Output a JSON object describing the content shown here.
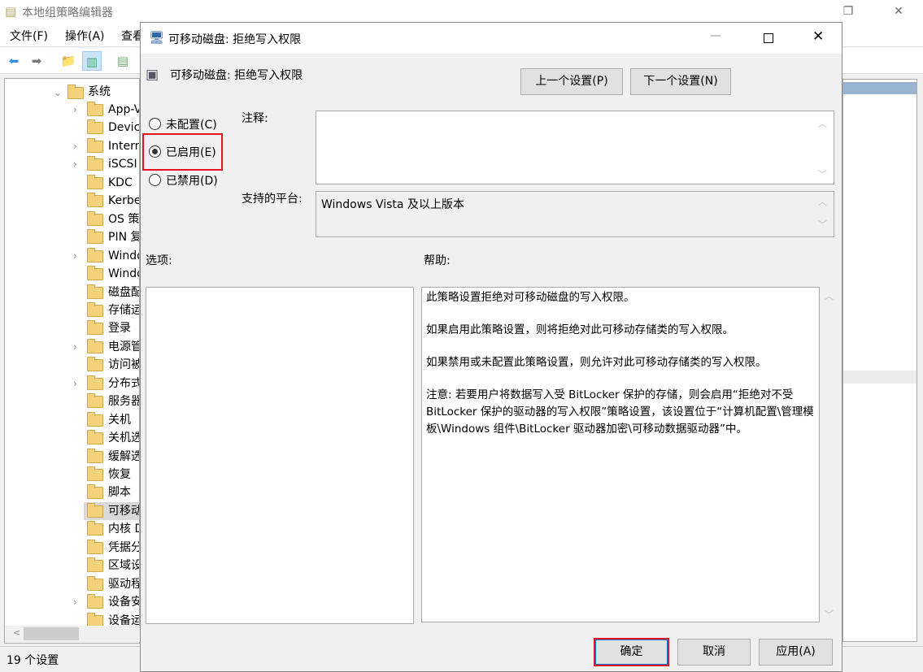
{
  "main_window": {
    "title": "本地组策略编辑器",
    "menu": [
      "文件(F)",
      "操作(A)",
      "查看"
    ],
    "tree": {
      "root": "系统",
      "items": [
        {
          "label": "App-V",
          "expandable": true
        },
        {
          "label": "Device",
          "expandable": false
        },
        {
          "label": "Internet",
          "expandable": true
        },
        {
          "label": "iSCSI",
          "expandable": true
        },
        {
          "label": "KDC",
          "expandable": false
        },
        {
          "label": "Kerberos",
          "expandable": false
        },
        {
          "label": "OS 策",
          "expandable": false
        },
        {
          "label": "PIN 复",
          "expandable": false
        },
        {
          "label": "Windows",
          "expandable": true
        },
        {
          "label": "Windows",
          "expandable": false
        },
        {
          "label": "磁盘配",
          "expandable": false
        },
        {
          "label": "存储运",
          "expandable": false
        },
        {
          "label": "登录",
          "expandable": false
        },
        {
          "label": "电源管",
          "expandable": true
        },
        {
          "label": "访问被",
          "expandable": false
        },
        {
          "label": "分布式",
          "expandable": true
        },
        {
          "label": "服务器",
          "expandable": false
        },
        {
          "label": "关机",
          "expandable": false
        },
        {
          "label": "关机选",
          "expandable": false
        },
        {
          "label": "缓解选",
          "expandable": false
        },
        {
          "label": "恢复",
          "expandable": false
        },
        {
          "label": "脚本",
          "expandable": false
        },
        {
          "label": "可移动",
          "expandable": false,
          "selected": true
        },
        {
          "label": "内核 D",
          "expandable": false
        },
        {
          "label": "凭据分",
          "expandable": false
        },
        {
          "label": "区域设",
          "expandable": false
        },
        {
          "label": "驱动程",
          "expandable": false
        },
        {
          "label": "设备安",
          "expandable": true
        },
        {
          "label": "设备运",
          "expandable": false
        }
      ]
    },
    "status": "19 个设置"
  },
  "dialog": {
    "title": "可移动磁盘: 拒绝写入权限",
    "heading": "可移动磁盘: 拒绝写入权限",
    "prev_button": "上一个设置(P)",
    "next_button": "下一个设置(N)",
    "radios": [
      {
        "label": "未配置(C)",
        "checked": false
      },
      {
        "label": "已启用(E)",
        "checked": true
      },
      {
        "label": "已禁用(D)",
        "checked": false
      }
    ],
    "comment_label": "注释:",
    "comment_value": "",
    "platform_label": "支持的平台:",
    "platform_value": "Windows Vista 及以上版本",
    "options_label": "选项:",
    "help_label": "帮助:",
    "help_paragraphs": [
      "此策略设置拒绝对可移动磁盘的写入权限。",
      "如果启用此策略设置，则将拒绝对此可移动存储类的写入权限。",
      "如果禁用或未配置此策略设置，则允许对此可移动存储类的写入权限。",
      "注意: 若要用户将数据写入受 BitLocker 保护的存储，则会启用“拒绝对不受 BitLocker 保护的驱动器的写入权限”策略设置，该设置位于“计算机配置\\管理模板\\Windows 组件\\BitLocker 驱动器加密\\可移动数据驱动器”中。"
    ],
    "ok_button": "确定",
    "cancel_button": "取消",
    "apply_button": "应用(A)",
    "highlight_color": "#e81123"
  }
}
